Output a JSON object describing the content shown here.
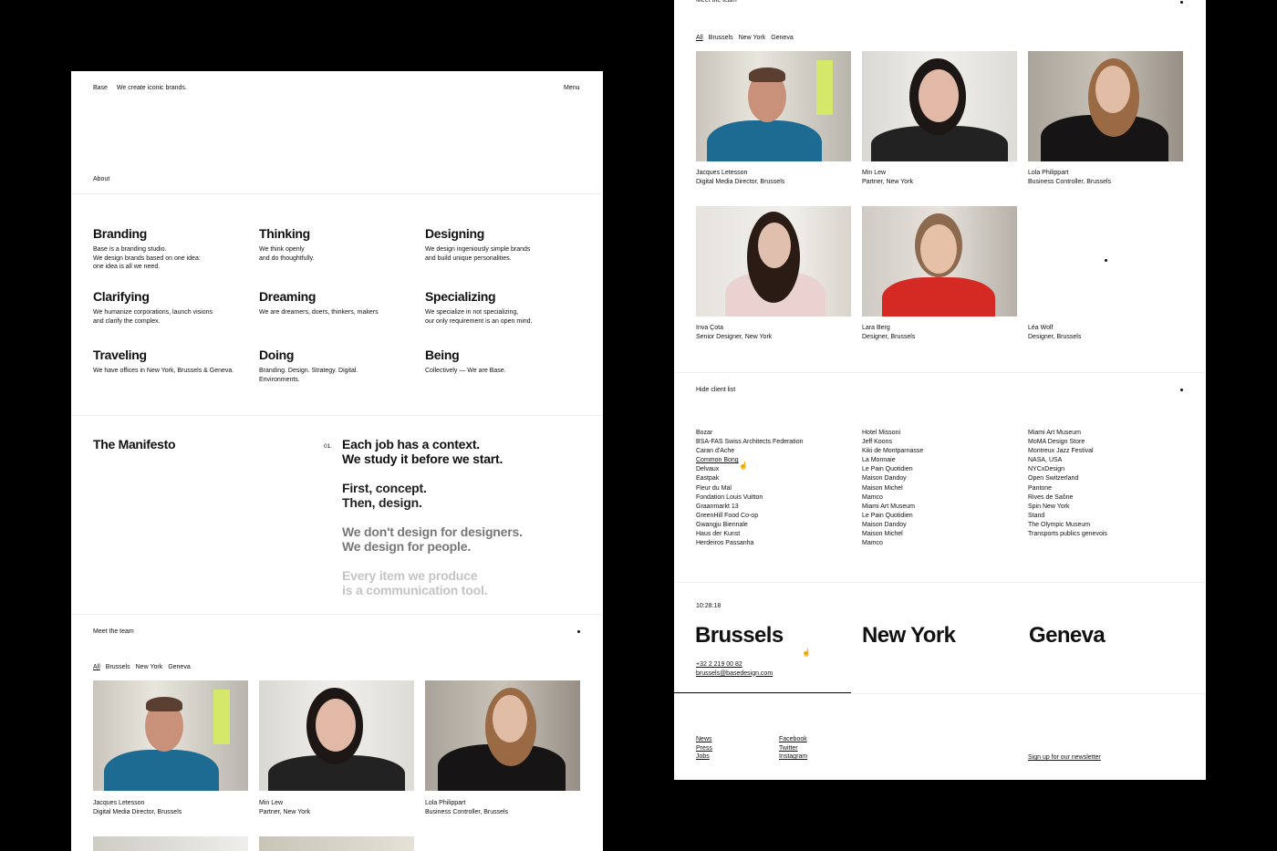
{
  "header": {
    "brand": "Base",
    "tagline": "We create iconic brands.",
    "menu_label": "Menu"
  },
  "about": {
    "label": "About",
    "items": [
      {
        "title": "Branding",
        "text": "Base is a branding studio.\nWe design brands based on one idea:\none idea is all we need."
      },
      {
        "title": "Thinking",
        "text": "We think openly\nand do thoughtfully."
      },
      {
        "title": "Designing",
        "text": "We design ingeniously simple brands\nand build unique personalities."
      },
      {
        "title": "Clarifying",
        "text": "We humanize corporations, launch visions\nand clarify the complex."
      },
      {
        "title": "Dreaming",
        "text": "We are dreamers, doers, thinkers, makers"
      },
      {
        "title": "Specializing",
        "text": "We specialize in not specializing,\nour only requirement is an open mind."
      },
      {
        "title": "Traveling",
        "text": "We have offices in New York, Brussels & Geneva."
      },
      {
        "title": "Doing",
        "text": "Branding. Design. Strategy. Digital.\nEnvironments."
      },
      {
        "title": "Being",
        "text": "Collectively — We are Base."
      }
    ]
  },
  "manifesto": {
    "title": "The Manifesto",
    "number": "01.",
    "lines": [
      {
        "l1": "Each job has a context.",
        "l2": "We study it before we start.",
        "color": "#111111"
      },
      {
        "l1": "First, concept.",
        "l2": "Then, design.",
        "color": "#222222"
      },
      {
        "l1": "We don't design for designers.",
        "l2": "We design for people.",
        "color": "#777777"
      },
      {
        "l1": "Every item we produce",
        "l2": "is a communication tool.",
        "color": "#c4c4c4"
      }
    ]
  },
  "team": {
    "label": "Meet the team",
    "filters": [
      "All",
      "Brussels",
      "New York",
      "Geneva"
    ],
    "members": [
      {
        "name": "Jacques Letesson",
        "role": "Digital Media Director, Brussels"
      },
      {
        "name": "Min Lew",
        "role": "Partner, New York"
      },
      {
        "name": "Lola Philippart",
        "role": "Business Controller, Brussels"
      },
      {
        "name": "Inva Çota",
        "role": "Senior Designer, New York"
      },
      {
        "name": "Lara Berg",
        "role": "Designer, Brussels"
      },
      {
        "name": "Léa Wolf",
        "role": "Designer, Brussels"
      }
    ]
  },
  "clients": {
    "toggle_label": "Hide client list",
    "columns": [
      [
        "Bozar",
        "BSA-FAS Swiss Architects Federation",
        "Caran d'Ache",
        "Common Bong",
        "Delvaux",
        "Eastpak",
        "Fleur du Mal",
        "Fondation Louis Vuitton",
        "Graanmarkt 13",
        "GreenHill Food Co-op",
        "Gwangju Biennale",
        "Haus der Kunst",
        "Herdeiros Passanha"
      ],
      [
        "Hotel Missoni",
        "Jeff Koons",
        "Kiki de Montparnasse",
        "La Monnaie",
        "Le Pain Quotidien",
        "Maison Dandoy",
        "Maison Michel",
        "Mamco",
        "Miami Art Museum",
        "Le Pain Quotidien",
        "Maison Dandoy",
        "Maison Michel",
        "Mamco"
      ],
      [
        "Miami Art Museum",
        "MoMA Design Store",
        "Montreux Jazz Festival",
        "NASA, USA",
        "NYCxDesign",
        "Open Switzerland",
        "Pantone",
        "Rives de Saône",
        "Spin New York",
        "Stand",
        "The Olympic Museum",
        "Transports publics genevois"
      ]
    ]
  },
  "offices": {
    "clock": "10:28:18",
    "cities": [
      "Brussels",
      "New York",
      "Geneva"
    ],
    "phone": "+32 2 219 00 82",
    "email": "brussels@basedesign.com"
  },
  "footer": {
    "links_a": [
      "News",
      "Press",
      "Jobs"
    ],
    "links_b": [
      "Facebook",
      "Twitter",
      "Instagram"
    ],
    "newsletter": "Sign up for our newsletter"
  }
}
